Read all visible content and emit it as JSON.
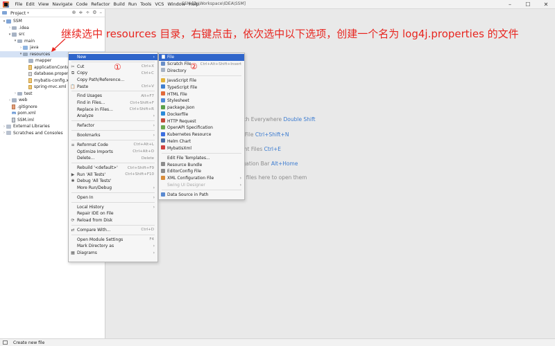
{
  "window": {
    "title": "SSM [D:\\Workspace\\IDEA\\SSM]"
  },
  "menubar": [
    "File",
    "Edit",
    "View",
    "Navigate",
    "Code",
    "Refactor",
    "Build",
    "Run",
    "Tools",
    "VCS",
    "Window",
    "Help"
  ],
  "project_panel": {
    "title": "Project"
  },
  "tree": [
    {
      "label": "SSM",
      "indent": 0,
      "arrow": "v",
      "icon": "folder-blue"
    },
    {
      "label": ".idea",
      "indent": 1,
      "arrow": ">",
      "icon": "folder"
    },
    {
      "label": "src",
      "indent": 1,
      "arrow": "v",
      "icon": "folder"
    },
    {
      "label": "main",
      "indent": 2,
      "arrow": "v",
      "icon": "folder"
    },
    {
      "label": "java",
      "indent": 3,
      "arrow": ">",
      "icon": "folder-src"
    },
    {
      "label": "resources",
      "indent": 3,
      "arrow": "v",
      "icon": "folder-res",
      "selected": true
    },
    {
      "label": "mapper",
      "indent": 4,
      "arrow": "",
      "icon": "folder"
    },
    {
      "label": "applicationConte",
      "indent": 4,
      "arrow": "",
      "icon": "xml"
    },
    {
      "label": "database.propert",
      "indent": 4,
      "arrow": "",
      "icon": "prop"
    },
    {
      "label": "mybatis-config.x",
      "indent": 4,
      "arrow": "",
      "icon": "xml"
    },
    {
      "label": "spring-mvc.xml",
      "indent": 4,
      "arrow": "",
      "icon": "xml"
    },
    {
      "label": "test",
      "indent": 2,
      "arrow": ">",
      "icon": "folder"
    },
    {
      "label": "web",
      "indent": 1,
      "arrow": ">",
      "icon": "folder"
    },
    {
      "label": ".gitignore",
      "indent": 1,
      "arrow": "",
      "icon": "git"
    },
    {
      "label": "pom.xml",
      "indent": 1,
      "arrow": "",
      "icon": "maven"
    },
    {
      "label": "SSM.iml",
      "indent": 1,
      "arrow": "",
      "icon": "iml"
    },
    {
      "label": "External Libraries",
      "indent": 0,
      "arrow": ">",
      "icon": "lib"
    },
    {
      "label": "Scratches and Consoles",
      "indent": 0,
      "arrow": ">",
      "icon": "lib"
    }
  ],
  "annotation": "继续选中 resources 目录，右键点击，依次选中以下选项，创建一个名为 log4j.properties 的文件",
  "markers": [
    "①",
    "②"
  ],
  "context_menu": [
    {
      "label": "New",
      "shortcut": "",
      "submenu": true,
      "active": true,
      "icon": ""
    },
    {
      "sep": true
    },
    {
      "label": "Cut",
      "shortcut": "Ctrl+X",
      "icon": "✂"
    },
    {
      "label": "Copy",
      "shortcut": "Ctrl+C",
      "icon": "⧉"
    },
    {
      "label": "Copy Path/Reference...",
      "shortcut": "",
      "icon": ""
    },
    {
      "label": "Paste",
      "shortcut": "Ctrl+V",
      "icon": "📋"
    },
    {
      "sep": true
    },
    {
      "label": "Find Usages",
      "shortcut": "Alt+F7",
      "icon": ""
    },
    {
      "label": "Find in Files...",
      "shortcut": "Ctrl+Shift+F",
      "icon": ""
    },
    {
      "label": "Replace in Files...",
      "shortcut": "Ctrl+Shift+R",
      "icon": ""
    },
    {
      "label": "Analyze",
      "shortcut": "",
      "submenu": true,
      "icon": ""
    },
    {
      "sep": true
    },
    {
      "label": "Refactor",
      "shortcut": "",
      "submenu": true,
      "icon": ""
    },
    {
      "sep": true
    },
    {
      "label": "Bookmarks",
      "shortcut": "",
      "submenu": true,
      "icon": ""
    },
    {
      "sep": true
    },
    {
      "label": "Reformat Code",
      "shortcut": "Ctrl+Alt+L",
      "icon": "≡"
    },
    {
      "label": "Optimize Imports",
      "shortcut": "Ctrl+Alt+O",
      "icon": ""
    },
    {
      "label": "Delete...",
      "shortcut": "Delete",
      "icon": ""
    },
    {
      "sep": true
    },
    {
      "label": "Rebuild '<default>'",
      "shortcut": "Ctrl+Shift+F9",
      "icon": ""
    },
    {
      "label": "Run 'All Tests'",
      "shortcut": "Ctrl+Shift+F10",
      "icon": "▶"
    },
    {
      "label": "Debug 'All Tests'",
      "shortcut": "",
      "icon": "✱"
    },
    {
      "label": "More Run/Debug",
      "shortcut": "",
      "submenu": true,
      "icon": ""
    },
    {
      "sep": true
    },
    {
      "label": "Open In",
      "shortcut": "",
      "submenu": true,
      "icon": ""
    },
    {
      "sep": true
    },
    {
      "label": "Local History",
      "shortcut": "",
      "submenu": true,
      "icon": ""
    },
    {
      "label": "Repair IDE on File",
      "shortcut": "",
      "icon": ""
    },
    {
      "label": "Reload from Disk",
      "shortcut": "",
      "icon": "⟳"
    },
    {
      "sep": true
    },
    {
      "label": "Compare With...",
      "shortcut": "Ctrl+D",
      "icon": "⇄"
    },
    {
      "sep": true
    },
    {
      "label": "Open Module Settings",
      "shortcut": "F4",
      "icon": ""
    },
    {
      "label": "Mark Directory as",
      "shortcut": "",
      "submenu": true,
      "icon": ""
    },
    {
      "label": "Diagrams",
      "shortcut": "",
      "submenu": true,
      "icon": "▦"
    }
  ],
  "submenu": [
    {
      "label": "File",
      "shortcut": "",
      "active": true,
      "icon": "file",
      "color": "#ffffff"
    },
    {
      "label": "Scratch File",
      "shortcut": "Ctrl+Alt+Shift+Insert",
      "icon": "scratch",
      "color": "#6b8fc7"
    },
    {
      "label": "Directory",
      "shortcut": "",
      "icon": "dir",
      "color": "#a7b3c4"
    },
    {
      "sep": true
    },
    {
      "label": "JavaScript File",
      "icon": "js",
      "color": "#e2b33a"
    },
    {
      "label": "TypeScript File",
      "icon": "ts",
      "color": "#3f7fcf"
    },
    {
      "label": "HTML File",
      "icon": "html",
      "color": "#e06a3a"
    },
    {
      "label": "Stylesheet",
      "icon": "css",
      "color": "#4f8ad8"
    },
    {
      "label": "package.json",
      "icon": "npm",
      "color": "#5aa04a"
    },
    {
      "label": "Dockerfile",
      "icon": "docker",
      "color": "#2b8ad8"
    },
    {
      "label": "HTTP Request",
      "icon": "http",
      "color": "#c44b3a"
    },
    {
      "label": "OpenAPI Specification",
      "icon": "openapi",
      "color": "#6aa84f"
    },
    {
      "label": "Kubernetes Resource",
      "icon": "k8s",
      "color": "#3c6ee0"
    },
    {
      "label": "Helm Chart",
      "icon": "helm",
      "color": "#4a6ea8"
    },
    {
      "label": "MybatisXml",
      "icon": "mybatis",
      "color": "#d04040"
    },
    {
      "sep": true
    },
    {
      "label": "Edit File Templates...",
      "icon": "",
      "color": ""
    },
    {
      "label": "Resource Bundle",
      "icon": "bundle",
      "color": "#8c8c8c"
    },
    {
      "label": "EditorConfig File",
      "icon": "editorconfig",
      "color": "#8c8c8c"
    },
    {
      "label": "XML Configuration File",
      "submenu": true,
      "icon": "xml",
      "color": "#d88c3a"
    },
    {
      "label": "Swing UI Designer",
      "submenu": true,
      "disabled": true,
      "icon": "",
      "color": ""
    },
    {
      "sep": true
    },
    {
      "label": "Data Source in Path",
      "icon": "db",
      "color": "#5a8ad0"
    }
  ],
  "editor_hints": [
    {
      "pre": "arch Everywhere ",
      "key": "Double Shift"
    },
    {
      "pre": "to File ",
      "key": "Ctrl+Shift+N"
    },
    {
      "pre": "cent Files ",
      "key": "Ctrl+E"
    },
    {
      "pre": "vigation Bar ",
      "key": "Alt+Home"
    },
    {
      "pre": "op files here to open them",
      "key": ""
    }
  ],
  "statusbar": {
    "text": "Create new file"
  }
}
